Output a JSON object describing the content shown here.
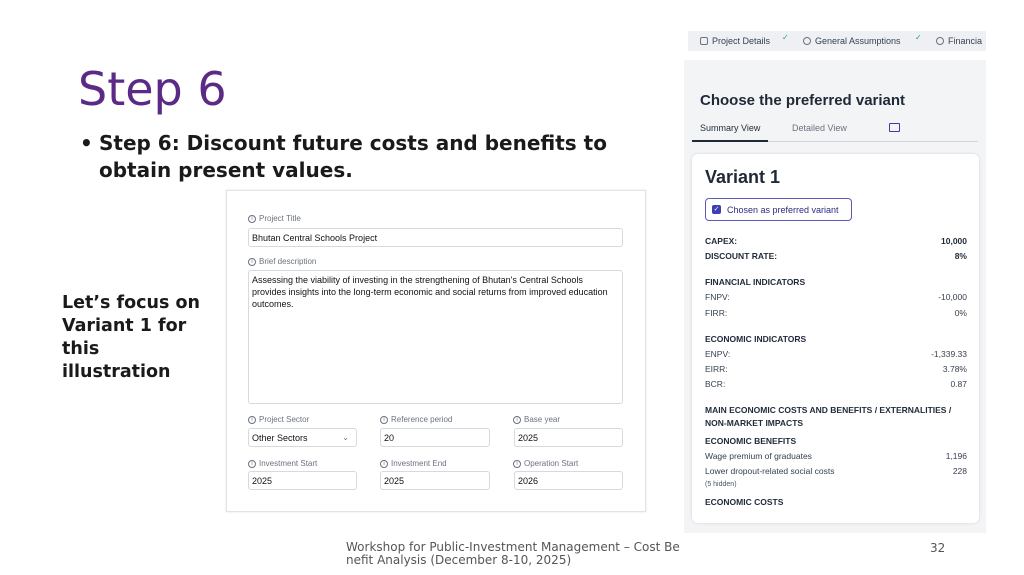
{
  "slide": {
    "title": "Step 6",
    "bullet": "Step 6: Discount future costs and benefits to obtain present values.",
    "focus_note": "Let’s focus on Variant 1 for this illustration",
    "footer": "Workshop for Public-Investment Management – Cost Benefit Analysis (December 8-10, 2025)",
    "page_number": "32"
  },
  "form": {
    "project_title_label": "Project Title",
    "project_title_value": "Bhutan Central Schools Project",
    "description_label": "Brief description",
    "description_value": "Assessing the viability of investing in the strengthening of Bhutan's Central Schools provides insights into the long-term economic and social returns from improved education outcomes.",
    "sector_label": "Project Sector",
    "sector_value": "Other Sectors",
    "reference_period_label": "Reference period",
    "reference_period_value": "20",
    "base_year_label": "Base year",
    "base_year_value": "2025",
    "investment_start_label": "Investment Start",
    "investment_start_value": "2025",
    "investment_end_label": "Investment End",
    "investment_end_value": "2025",
    "operation_start_label": "Operation Start",
    "operation_start_value": "2026"
  },
  "tabs": [
    {
      "label": "Project Details",
      "icon": "clipboard-icon",
      "completed": true
    },
    {
      "label": "General Assumptions",
      "icon": "settings-icon",
      "completed": true
    },
    {
      "label": "Financia",
      "icon": "dollar-icon",
      "completed": false
    }
  ],
  "panel": {
    "title": "Choose the preferred variant",
    "view_tabs": [
      "Summary View",
      "Detailed View"
    ],
    "active_view": "Summary View",
    "variant_name": "Variant 1",
    "chosen_label": "Chosen as preferred variant",
    "capex_label": "CAPEX:",
    "capex_value": "10,000",
    "discount_label": "DISCOUNT RATE:",
    "discount_value": "8%",
    "financial_header": "FINANCIAL INDICATORS",
    "fnpv_label": "FNPV:",
    "fnpv_value": "-10,000",
    "firr_label": "FIRR:",
    "firr_value": "0%",
    "economic_header": "ECONOMIC INDICATORS",
    "enpv_label": "ENPV:",
    "enpv_value": "-1,339.33",
    "eirr_label": "EIRR:",
    "eirr_value": "3.78%",
    "bcr_label": "BCR:",
    "bcr_value": "0.87",
    "main_header": "MAIN ECONOMIC COSTS AND BENEFITS / EXTERNALITIES / NON-MARKET IMPACTS",
    "benefits_header": "ECONOMIC BENEFITS",
    "wage_label": "Wage premium of graduates",
    "wage_value": "1,196",
    "dropout_label": "Lower dropout-related social costs",
    "dropout_value": "228",
    "hidden_note": "(5 hidden)",
    "costs_header": "ECONOMIC COSTS"
  },
  "colors": {
    "title": "#5b2a86",
    "accent": "#3d3db4",
    "check": "#1ea672"
  }
}
